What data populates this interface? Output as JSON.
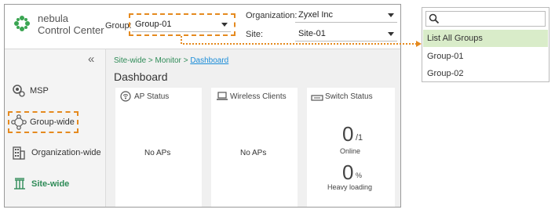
{
  "header": {
    "logo_line1": "nebula",
    "logo_line2": "Control Center",
    "group_label": "Group:",
    "group_value": "Group-01",
    "org_label": "Organization:",
    "org_value": "Zyxel Inc",
    "site_label": "Site:",
    "site_value": "Site-01"
  },
  "sidebar": {
    "collapse_glyph": "«",
    "items": [
      {
        "label": "MSP",
        "icon": "msp-gear-icon"
      },
      {
        "label": "Group-wide",
        "icon": "group-nodes-icon"
      },
      {
        "label": "Organization-wide",
        "icon": "building-icon"
      },
      {
        "label": "Site-wide",
        "icon": "site-icon"
      }
    ]
  },
  "breadcrumb": {
    "part1": "Site-wide",
    "sep1": ">",
    "part2": "Monitor",
    "sep2": ">",
    "part3": "Dashboard"
  },
  "page_title": "Dashboard",
  "cards": {
    "ap": {
      "title": "AP Status",
      "empty": "No APs"
    },
    "wireless": {
      "title": "Wireless Clients",
      "empty": "No APs"
    },
    "switch": {
      "title": "Switch Status",
      "online_value": "0",
      "online_total": "/1",
      "online_label": "Online",
      "loading_value": "0",
      "loading_unit": "%",
      "loading_label": "Heavy loading"
    }
  },
  "dropdown": {
    "items": [
      "List All Groups",
      "Group-01",
      "Group-02"
    ],
    "active_index": 0
  },
  "colors": {
    "accent_green": "#2e8b57",
    "highlight_orange": "#e58a1f",
    "dropdown_active": "#d9ecc9",
    "link_blue": "#1a8cd8"
  }
}
